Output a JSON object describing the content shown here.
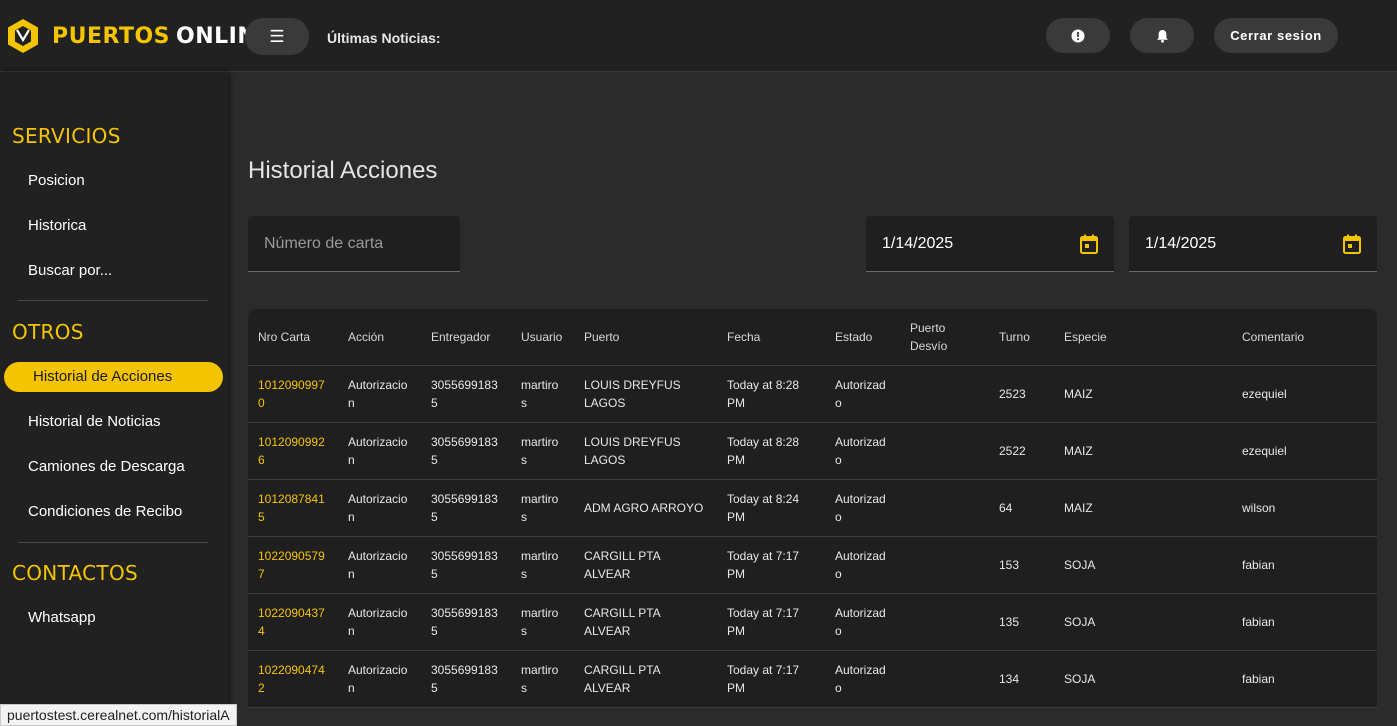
{
  "header": {
    "logo_part1": "PUERTOS",
    "logo_part2": "ONLINE",
    "menu_icon": "☰",
    "news_label": "Últimas Noticias:",
    "logout_label": "Cerrar sesion"
  },
  "sidebar": {
    "servicios_title": "SERVICIOS",
    "servicios": [
      "Posicion",
      "Historica",
      "Buscar por..."
    ],
    "otros_title": "OTROS",
    "otros": [
      "Historial de Acciones",
      "Historial de Noticias",
      "Camiones de Descarga",
      "Condiciones de Recibo"
    ],
    "contactos_title": "CONTACTOS",
    "contactos": [
      "Whatsapp"
    ]
  },
  "main": {
    "title": "Historial Acciones",
    "search_placeholder": "Número de carta",
    "date_from": "1/14/2025",
    "date_to": "1/14/2025"
  },
  "table": {
    "headers": [
      "Nro Carta",
      "Acción",
      "Entregador",
      "Usuario",
      "Puerto",
      "Fecha",
      "Estado",
      "Puerto Desvío",
      "Turno",
      "Especie",
      "Comentario"
    ],
    "rows": [
      [
        "10120909970",
        "Autorizacion",
        "30556991835",
        "martiros",
        "LOUIS DREYFUS LAGOS",
        "Today at 8:28 PM",
        "Autorizado",
        "",
        "2523",
        "MAIZ",
        "ezequiel"
      ],
      [
        "10120909926",
        "Autorizacion",
        "30556991835",
        "martiros",
        "LOUIS DREYFUS LAGOS",
        "Today at 8:28 PM",
        "Autorizado",
        "",
        "2522",
        "MAIZ",
        "ezequiel"
      ],
      [
        "10120878415",
        "Autorizacion",
        "30556991835",
        "martiros",
        "ADM AGRO ARROYO",
        "Today at 8:24 PM",
        "Autorizado",
        "",
        "64",
        "MAIZ",
        "wilson"
      ],
      [
        "10220905797",
        "Autorizacion",
        "30556991835",
        "martiros",
        "CARGILL PTA ALVEAR",
        "Today at 7:17 PM",
        "Autorizado",
        "",
        "153",
        "SOJA",
        "fabian"
      ],
      [
        "10220904374",
        "Autorizacion",
        "30556991835",
        "martiros",
        "CARGILL PTA ALVEAR",
        "Today at 7:17 PM",
        "Autorizado",
        "",
        "135",
        "SOJA",
        "fabian"
      ],
      [
        "10220904742",
        "Autorizacion",
        "30556991835",
        "martiros",
        "CARGILL PTA ALVEAR",
        "Today at 7:17 PM",
        "Autorizado",
        "",
        "134",
        "SOJA",
        "fabian"
      ]
    ]
  },
  "status_url": "puertostest.cerealnet.com/historialA",
  "colors": {
    "accent": "#f5c400",
    "background": "#2b2b2b",
    "panel": "#212121"
  }
}
